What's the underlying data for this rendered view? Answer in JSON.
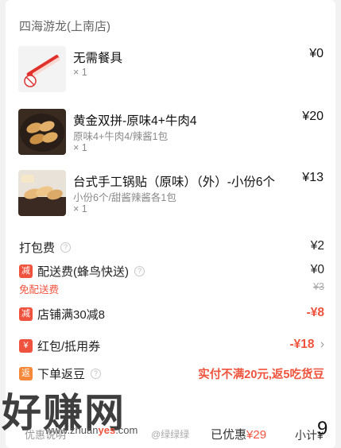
{
  "shop_name": "四海游龙(上南店)",
  "items": [
    {
      "name": "无需餐具",
      "price": "¥0",
      "spec": "",
      "qty": "× 1",
      "thumb_icon": "no-cutlery-icon"
    },
    {
      "name": "黄金双拼-原味4+牛肉4",
      "price": "¥20",
      "spec": "原味4+牛肉4/辣酱1包",
      "qty": "× 1",
      "thumb_icon": "dumplings-photo"
    },
    {
      "name": "台式手工锅贴（原味）（外）-小份6个",
      "price": "¥13",
      "spec": "小份6个/甜酱辣酱各1包",
      "qty": "× 1",
      "thumb_icon": "potstickers-photo"
    }
  ],
  "fees": {
    "packing": {
      "label": "打包费",
      "value": "¥2"
    },
    "delivery": {
      "badge": "减",
      "label": "配送费(蜂鸟快送)",
      "value": "¥0",
      "original": "¥3",
      "note": "免配送费"
    },
    "store_discount": {
      "badge": "减",
      "label": "店铺满30减8",
      "value": "-¥8"
    },
    "coupon": {
      "badge": "¥",
      "label": "红包/抵用券",
      "value": "-¥18",
      "arrow": "›"
    },
    "cashback": {
      "badge": "返",
      "label": "下单返豆",
      "value": "实付不满20元,返5吃货豆"
    }
  },
  "watermark": {
    "text": "好赚网",
    "url_prefix": "www.zhuan",
    "url_highlight": "yes",
    "url_suffix": ".com"
  },
  "footer": {
    "discount_note": "优惠说明",
    "weibo": "@绿绿绿",
    "saved_label": "已优惠",
    "saved_value": "¥29",
    "subtotal_label": "小计¥",
    "subtotal_value": "9"
  },
  "colors": {
    "accent": "#f0533d",
    "cashback_badge": "#f6883a"
  }
}
